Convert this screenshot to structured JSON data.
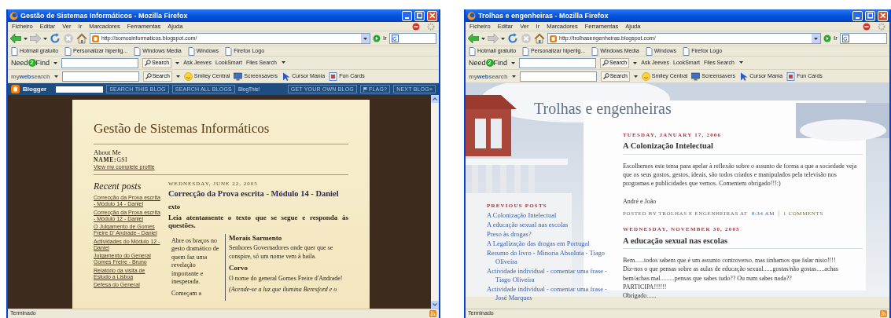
{
  "windows": [
    {
      "title": "Gestão de Sistemas Informáticos - Mozilla Firefox",
      "menu": [
        "Ficheiro",
        "Editar",
        "Ver",
        "Ir",
        "Marcadores",
        "Ferramentas",
        "Ajuda"
      ],
      "address": "http://somosinformaticos.blogspot.com/",
      "go_label": "Ir",
      "bookmarks": [
        "Hotmail gratuito",
        "Personalizar hiperlig...",
        "Windows Media",
        "Windows",
        "Firefox Logo"
      ],
      "toolbars": [
        {
          "kind": "need2find",
          "brand": [
            "Need",
            "2",
            "Find"
          ],
          "button": "Search",
          "links": [
            {
              "label": "Ask Jeeves",
              "menu": false
            },
            {
              "label": "LookSmart",
              "menu": false
            },
            {
              "label": "Files Search",
              "menu": true
            }
          ]
        },
        {
          "kind": "mywebsearch",
          "brand": [
            "my",
            "web",
            "search"
          ],
          "button": "Search",
          "links": [
            {
              "label": "Smiley Central",
              "menu": false
            },
            {
              "label": "Screensavers",
              "menu": false
            },
            {
              "label": "Cursor Mania",
              "menu": false
            },
            {
              "label": "Fun Cards",
              "menu": false
            }
          ]
        }
      ],
      "blogger_bar": {
        "logo": "Blogger",
        "buttons": [
          "SEARCH THIS BLOG",
          "SEARCH ALL BLOGS"
        ],
        "link": "BlogThis!",
        "right_buttons": [
          "GET YOUR OWN BLOG",
          "FLAG?",
          "NEXT BLOG»"
        ]
      },
      "page": {
        "kind": "paper",
        "blog_title": "Gestão de Sistemas Informáticos",
        "about_heading": "About Me",
        "name_label": "NAME:",
        "name": "GSI",
        "profile_link": "View my complete profile",
        "sidebar_heading": "Recent posts",
        "recent_posts": [
          "Correcção da Prova escrita - Módulo 14 - Daniel",
          "Correcção da Prova escrita - Módulo 12 - Daniel",
          "O Julgamento de Gomes Freire D' Andrade - Daniel",
          "Actividades do Módulo 12 - Daniel",
          "Julgamento do General Gomes Freire - Bruno",
          "Relatório da visita de Estudo a Lisboa",
          "Defesa do General"
        ],
        "post": {
          "date": "WEDNESDAY, JUNE 22, 2005",
          "title": "Correcção da Prova escrita - Módulo 14 - Daniel",
          "subheading": "exto",
          "intro": "Leia atentamente o texto que se segue e responda às questões.",
          "left_column": [
            "Abre os braços no gesto dramático de quem faz uma revelação importante e inesperada.",
            "Começam a"
          ],
          "right_column": [
            {
              "kind": "speaker",
              "text": "Morais Sarmento"
            },
            {
              "kind": "line",
              "text": "Senhores Governadores onde quer que se conspire, só um nome vem à baila."
            },
            {
              "kind": "speaker",
              "text": "Corvo"
            },
            {
              "kind": "line",
              "text": "O nome do general Gomes Freire d'Andrade!"
            },
            {
              "kind": "direction",
              "text": "(Acende-se a luz que ilumina Beresford e o"
            }
          ]
        }
      },
      "status": "Terminado"
    },
    {
      "title": "Trolhas e engenheiras - Mozilla Firefox",
      "menu": [
        "Ficheiro",
        "Editar",
        "Ver",
        "Ir",
        "Marcadores",
        "Ferramentas",
        "Ajuda"
      ],
      "address": "http://trolhasengenheiras.blogspot.com/",
      "go_label": "Ir",
      "bookmarks": [
        "Hotmail gratuito",
        "Personalizar hiperlig...",
        "Windows Media",
        "Windows",
        "Firefox Logo"
      ],
      "toolbars": [
        {
          "kind": "need2find",
          "brand": [
            "Need",
            "2",
            "Find"
          ],
          "button": "Search",
          "links": [
            {
              "label": "Ask Jeeves",
              "menu": false
            },
            {
              "label": "LookSmart",
              "menu": false
            },
            {
              "label": "Files Search",
              "menu": true
            }
          ]
        },
        {
          "kind": "mywebsearch",
          "brand": [
            "my",
            "web",
            "search"
          ],
          "button": "Search",
          "links": [
            {
              "label": "Smiley Central",
              "menu": false
            },
            {
              "label": "Screensavers",
              "menu": false
            },
            {
              "label": "Cursor Mania",
              "menu": false
            },
            {
              "label": "Fun Cards",
              "menu": false
            }
          ]
        }
      ],
      "page": {
        "kind": "sky",
        "blog_title": "Trolhas e engenheiras",
        "sidebar_heading": "PREVIOUS POSTS",
        "previous_posts": [
          "A Colonização Intelectual",
          "A educação sexual nas escolas",
          "Preso às drogas?",
          "A Legalização das drogas em Portugal",
          "Resumo do livro - Minoria Absoluta - Tiago Oliveira",
          "Actividade individual - comentar uma frase - Tiago Oliveira",
          "Actividade individual - comentar uma frase - José Marques"
        ],
        "posts": [
          {
            "date": "TUESDAY, JANUARY 17, 2006",
            "title": "A Colonização Intelectual",
            "paragraphs": [
              "Escolhemos este tema para apelar à reflexão sobre o assunto de forma a que a sociedade veja que os seus gostos, gestos, ideais, são todos criados e manipulados pela televisão nos programas e publicidades que vemos. Comentem obrigado!!!:)",
              "André e João"
            ],
            "footer": {
              "posted_by": "POSTED BY TROLHAS E ENGENHEIRAS AT",
              "time": "8:34 AM",
              "comments": "1 COMMENTS"
            }
          },
          {
            "date": "WEDNESDAY, NOVEMBER 30, 2005",
            "title": "A educação sexual nas escolas",
            "paragraphs": [
              "Bem......todos sabem que é um assunto controverso, mas tinhamos que falar nisto!!!!",
              "Diz-nos o que pensas sobre as aulas de educação sexual......gostas/não gostas.....achas bem/achas mal.........pensas que sabes tudo?? Ou num sabes nada??",
              "PARTICIPA!!!!!!",
              "Obrigado......"
            ]
          }
        ]
      },
      "status": "Terminado"
    }
  ]
}
